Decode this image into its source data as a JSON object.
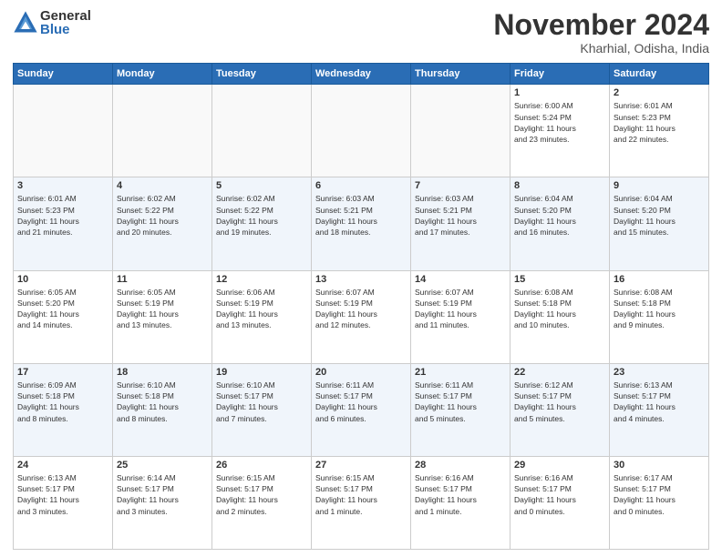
{
  "header": {
    "logo_general": "General",
    "logo_blue": "Blue",
    "month_title": "November 2024",
    "location": "Kharhial, Odisha, India"
  },
  "weekdays": [
    "Sunday",
    "Monday",
    "Tuesday",
    "Wednesday",
    "Thursday",
    "Friday",
    "Saturday"
  ],
  "weeks": [
    [
      {
        "day": "",
        "info": ""
      },
      {
        "day": "",
        "info": ""
      },
      {
        "day": "",
        "info": ""
      },
      {
        "day": "",
        "info": ""
      },
      {
        "day": "",
        "info": ""
      },
      {
        "day": "1",
        "info": "Sunrise: 6:00 AM\nSunset: 5:24 PM\nDaylight: 11 hours\nand 23 minutes."
      },
      {
        "day": "2",
        "info": "Sunrise: 6:01 AM\nSunset: 5:23 PM\nDaylight: 11 hours\nand 22 minutes."
      }
    ],
    [
      {
        "day": "3",
        "info": "Sunrise: 6:01 AM\nSunset: 5:23 PM\nDaylight: 11 hours\nand 21 minutes."
      },
      {
        "day": "4",
        "info": "Sunrise: 6:02 AM\nSunset: 5:22 PM\nDaylight: 11 hours\nand 20 minutes."
      },
      {
        "day": "5",
        "info": "Sunrise: 6:02 AM\nSunset: 5:22 PM\nDaylight: 11 hours\nand 19 minutes."
      },
      {
        "day": "6",
        "info": "Sunrise: 6:03 AM\nSunset: 5:21 PM\nDaylight: 11 hours\nand 18 minutes."
      },
      {
        "day": "7",
        "info": "Sunrise: 6:03 AM\nSunset: 5:21 PM\nDaylight: 11 hours\nand 17 minutes."
      },
      {
        "day": "8",
        "info": "Sunrise: 6:04 AM\nSunset: 5:20 PM\nDaylight: 11 hours\nand 16 minutes."
      },
      {
        "day": "9",
        "info": "Sunrise: 6:04 AM\nSunset: 5:20 PM\nDaylight: 11 hours\nand 15 minutes."
      }
    ],
    [
      {
        "day": "10",
        "info": "Sunrise: 6:05 AM\nSunset: 5:20 PM\nDaylight: 11 hours\nand 14 minutes."
      },
      {
        "day": "11",
        "info": "Sunrise: 6:05 AM\nSunset: 5:19 PM\nDaylight: 11 hours\nand 13 minutes."
      },
      {
        "day": "12",
        "info": "Sunrise: 6:06 AM\nSunset: 5:19 PM\nDaylight: 11 hours\nand 13 minutes."
      },
      {
        "day": "13",
        "info": "Sunrise: 6:07 AM\nSunset: 5:19 PM\nDaylight: 11 hours\nand 12 minutes."
      },
      {
        "day": "14",
        "info": "Sunrise: 6:07 AM\nSunset: 5:19 PM\nDaylight: 11 hours\nand 11 minutes."
      },
      {
        "day": "15",
        "info": "Sunrise: 6:08 AM\nSunset: 5:18 PM\nDaylight: 11 hours\nand 10 minutes."
      },
      {
        "day": "16",
        "info": "Sunrise: 6:08 AM\nSunset: 5:18 PM\nDaylight: 11 hours\nand 9 minutes."
      }
    ],
    [
      {
        "day": "17",
        "info": "Sunrise: 6:09 AM\nSunset: 5:18 PM\nDaylight: 11 hours\nand 8 minutes."
      },
      {
        "day": "18",
        "info": "Sunrise: 6:10 AM\nSunset: 5:18 PM\nDaylight: 11 hours\nand 8 minutes."
      },
      {
        "day": "19",
        "info": "Sunrise: 6:10 AM\nSunset: 5:17 PM\nDaylight: 11 hours\nand 7 minutes."
      },
      {
        "day": "20",
        "info": "Sunrise: 6:11 AM\nSunset: 5:17 PM\nDaylight: 11 hours\nand 6 minutes."
      },
      {
        "day": "21",
        "info": "Sunrise: 6:11 AM\nSunset: 5:17 PM\nDaylight: 11 hours\nand 5 minutes."
      },
      {
        "day": "22",
        "info": "Sunrise: 6:12 AM\nSunset: 5:17 PM\nDaylight: 11 hours\nand 5 minutes."
      },
      {
        "day": "23",
        "info": "Sunrise: 6:13 AM\nSunset: 5:17 PM\nDaylight: 11 hours\nand 4 minutes."
      }
    ],
    [
      {
        "day": "24",
        "info": "Sunrise: 6:13 AM\nSunset: 5:17 PM\nDaylight: 11 hours\nand 3 minutes."
      },
      {
        "day": "25",
        "info": "Sunrise: 6:14 AM\nSunset: 5:17 PM\nDaylight: 11 hours\nand 3 minutes."
      },
      {
        "day": "26",
        "info": "Sunrise: 6:15 AM\nSunset: 5:17 PM\nDaylight: 11 hours\nand 2 minutes."
      },
      {
        "day": "27",
        "info": "Sunrise: 6:15 AM\nSunset: 5:17 PM\nDaylight: 11 hours\nand 1 minute."
      },
      {
        "day": "28",
        "info": "Sunrise: 6:16 AM\nSunset: 5:17 PM\nDaylight: 11 hours\nand 1 minute."
      },
      {
        "day": "29",
        "info": "Sunrise: 6:16 AM\nSunset: 5:17 PM\nDaylight: 11 hours\nand 0 minutes."
      },
      {
        "day": "30",
        "info": "Sunrise: 6:17 AM\nSunset: 5:17 PM\nDaylight: 11 hours\nand 0 minutes."
      }
    ]
  ]
}
